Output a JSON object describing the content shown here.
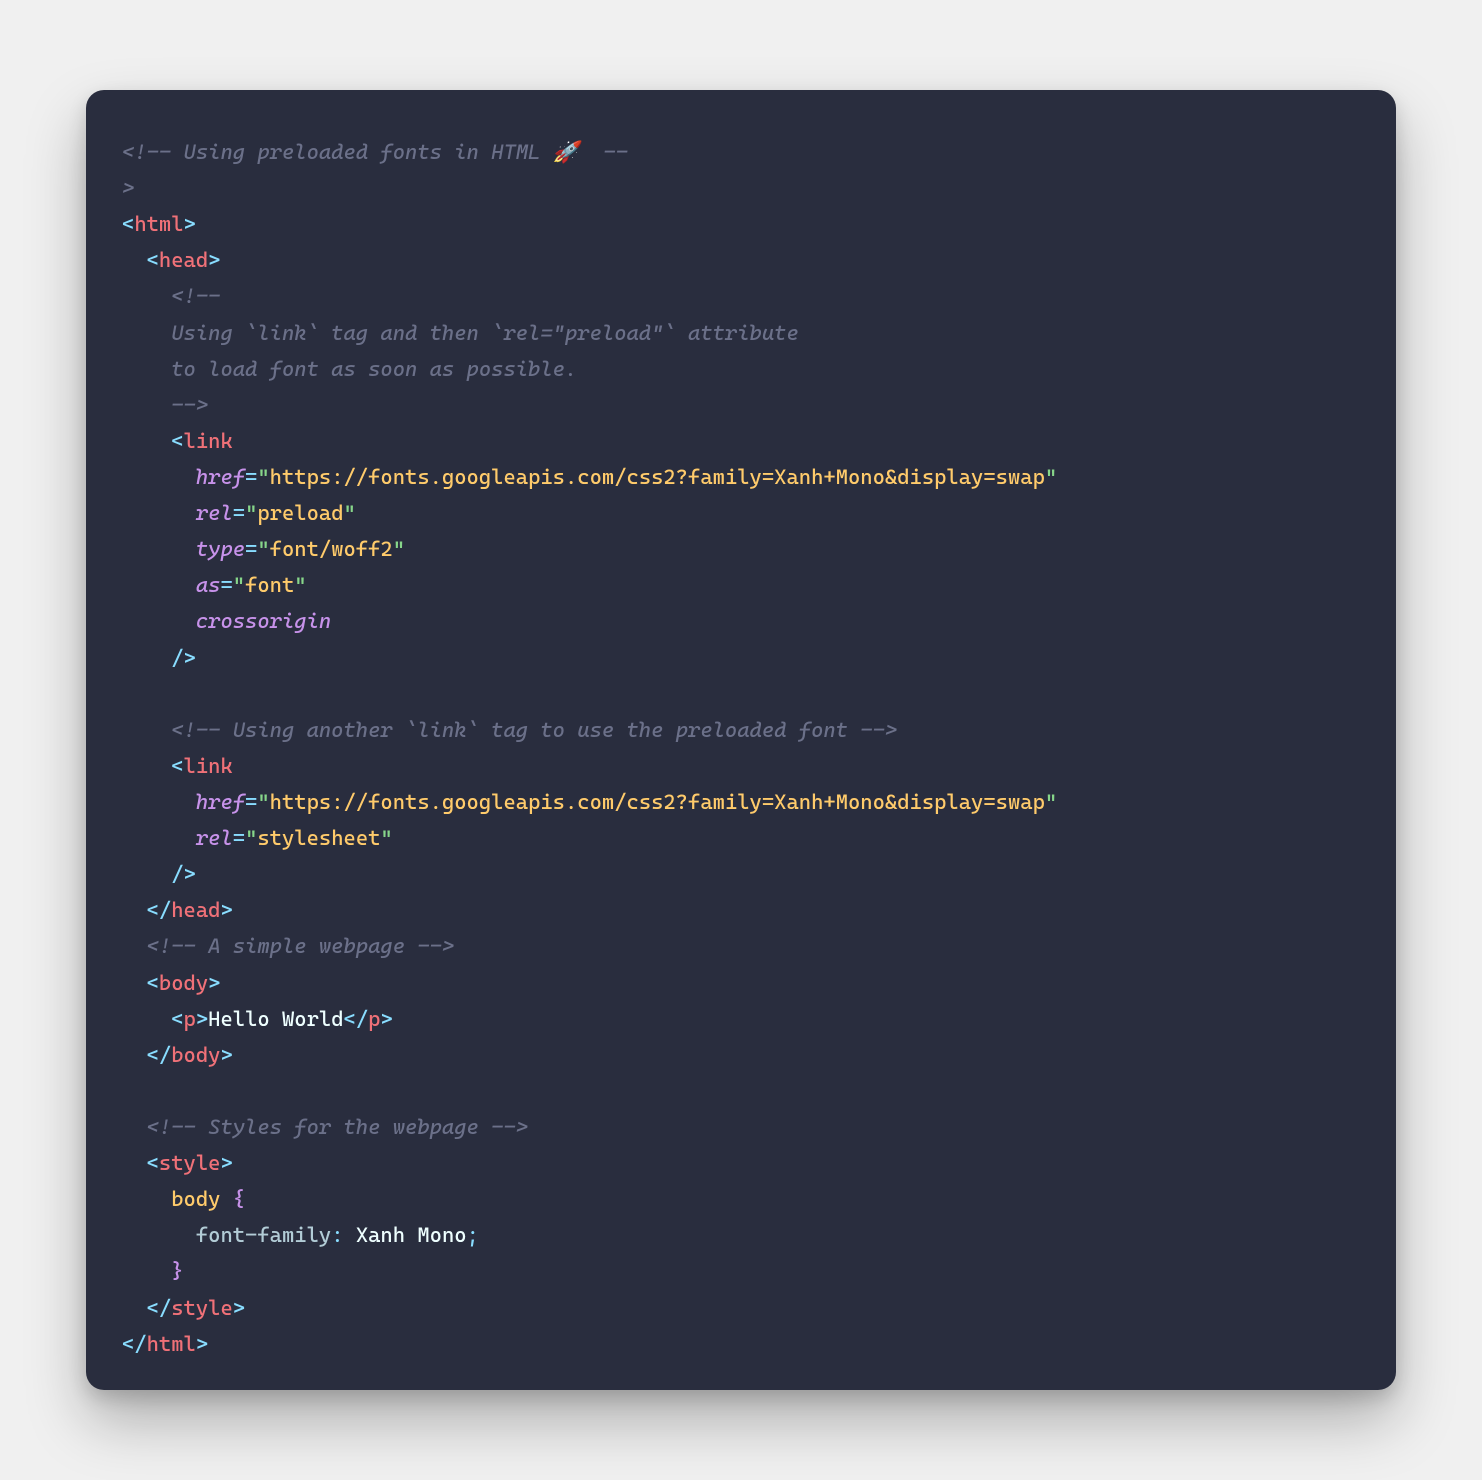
{
  "colors": {
    "background_page": "#f0f0f0",
    "background_card": "#292d3e",
    "comment": "#6b7089",
    "punctuation": "#89ddff",
    "tag": "#f07178",
    "attribute": "#c792ea",
    "string_value": "#ffcb6b",
    "string_quote": "#87d68a",
    "text": "#eeffff",
    "css_property": "#b2ccd6"
  },
  "lines": [
    [
      {
        "cls": "cm",
        "t": "<!-- Using preloaded fonts in HTML 🚀  --"
      }
    ],
    [
      {
        "cls": "cm",
        "t": ">"
      }
    ],
    [
      {
        "cls": "pn",
        "t": "<"
      },
      {
        "cls": "tg",
        "t": "html"
      },
      {
        "cls": "pn",
        "t": ">"
      }
    ],
    [
      {
        "t": "  "
      },
      {
        "cls": "pn",
        "t": "<"
      },
      {
        "cls": "tg",
        "t": "head"
      },
      {
        "cls": "pn",
        "t": ">"
      }
    ],
    [
      {
        "t": "    "
      },
      {
        "cls": "cm",
        "t": "<!--"
      }
    ],
    [
      {
        "t": "    "
      },
      {
        "cls": "cm",
        "t": "Using `link` tag and then `rel=\"preload\"` attribute"
      }
    ],
    [
      {
        "t": "    "
      },
      {
        "cls": "cm",
        "t": "to load font as soon as possible."
      }
    ],
    [
      {
        "t": "    "
      },
      {
        "cls": "cm",
        "t": "-->"
      }
    ],
    [
      {
        "t": "    "
      },
      {
        "cls": "pn",
        "t": "<"
      },
      {
        "cls": "tg",
        "t": "link"
      }
    ],
    [
      {
        "t": "      "
      },
      {
        "cls": "at",
        "t": "href"
      },
      {
        "cls": "eq",
        "t": "="
      },
      {
        "cls": "sq",
        "t": "\""
      },
      {
        "cls": "st",
        "t": "https://fonts.googleapis.com/css2?family=Xanh+Mono&display=swap"
      },
      {
        "cls": "sq",
        "t": "\""
      }
    ],
    [
      {
        "t": "      "
      },
      {
        "cls": "at",
        "t": "rel"
      },
      {
        "cls": "eq",
        "t": "="
      },
      {
        "cls": "sq",
        "t": "\""
      },
      {
        "cls": "st",
        "t": "preload"
      },
      {
        "cls": "sq",
        "t": "\""
      }
    ],
    [
      {
        "t": "      "
      },
      {
        "cls": "at",
        "t": "type"
      },
      {
        "cls": "eq",
        "t": "="
      },
      {
        "cls": "sq",
        "t": "\""
      },
      {
        "cls": "st",
        "t": "font/woff2"
      },
      {
        "cls": "sq",
        "t": "\""
      }
    ],
    [
      {
        "t": "      "
      },
      {
        "cls": "at",
        "t": "as"
      },
      {
        "cls": "eq",
        "t": "="
      },
      {
        "cls": "sq",
        "t": "\""
      },
      {
        "cls": "st",
        "t": "font"
      },
      {
        "cls": "sq",
        "t": "\""
      }
    ],
    [
      {
        "t": "      "
      },
      {
        "cls": "at",
        "t": "crossorigin"
      }
    ],
    [
      {
        "t": "    "
      },
      {
        "cls": "pn",
        "t": "/>"
      }
    ],
    [
      {
        "t": " "
      }
    ],
    [
      {
        "t": "    "
      },
      {
        "cls": "cm",
        "t": "<!-- Using another `link` tag to use the preloaded font -->"
      }
    ],
    [
      {
        "t": "    "
      },
      {
        "cls": "pn",
        "t": "<"
      },
      {
        "cls": "tg",
        "t": "link"
      }
    ],
    [
      {
        "t": "      "
      },
      {
        "cls": "at",
        "t": "href"
      },
      {
        "cls": "eq",
        "t": "="
      },
      {
        "cls": "sq",
        "t": "\""
      },
      {
        "cls": "st",
        "t": "https://fonts.googleapis.com/css2?family=Xanh+Mono&display=swap"
      },
      {
        "cls": "sq",
        "t": "\""
      }
    ],
    [
      {
        "t": "      "
      },
      {
        "cls": "at",
        "t": "rel"
      },
      {
        "cls": "eq",
        "t": "="
      },
      {
        "cls": "sq",
        "t": "\""
      },
      {
        "cls": "st",
        "t": "stylesheet"
      },
      {
        "cls": "sq",
        "t": "\""
      }
    ],
    [
      {
        "t": "    "
      },
      {
        "cls": "pn",
        "t": "/>"
      }
    ],
    [
      {
        "t": "  "
      },
      {
        "cls": "pn",
        "t": "</"
      },
      {
        "cls": "tg",
        "t": "head"
      },
      {
        "cls": "pn",
        "t": ">"
      }
    ],
    [
      {
        "t": "  "
      },
      {
        "cls": "cm",
        "t": "<!-- A simple webpage -->"
      }
    ],
    [
      {
        "t": "  "
      },
      {
        "cls": "pn",
        "t": "<"
      },
      {
        "cls": "tg",
        "t": "body"
      },
      {
        "cls": "pn",
        "t": ">"
      }
    ],
    [
      {
        "t": "    "
      },
      {
        "cls": "pn",
        "t": "<"
      },
      {
        "cls": "tg",
        "t": "p"
      },
      {
        "cls": "pn",
        "t": ">"
      },
      {
        "cls": "tx",
        "t": "Hello World"
      },
      {
        "cls": "pn",
        "t": "</"
      },
      {
        "cls": "tg",
        "t": "p"
      },
      {
        "cls": "pn",
        "t": ">"
      }
    ],
    [
      {
        "t": "  "
      },
      {
        "cls": "pn",
        "t": "</"
      },
      {
        "cls": "tg",
        "t": "body"
      },
      {
        "cls": "pn",
        "t": ">"
      }
    ],
    [
      {
        "t": " "
      }
    ],
    [
      {
        "t": "  "
      },
      {
        "cls": "cm",
        "t": "<!-- Styles for the webpage -->"
      }
    ],
    [
      {
        "t": "  "
      },
      {
        "cls": "pn",
        "t": "<"
      },
      {
        "cls": "tg",
        "t": "style"
      },
      {
        "cls": "pn",
        "t": ">"
      }
    ],
    [
      {
        "t": "    "
      },
      {
        "cls": "sel",
        "t": "body"
      },
      {
        "t": " "
      },
      {
        "cls": "bkt",
        "t": "{"
      }
    ],
    [
      {
        "t": "      "
      },
      {
        "cls": "prop",
        "t": "font-family"
      },
      {
        "cls": "pn",
        "t": ":"
      },
      {
        "t": " "
      },
      {
        "cls": "val",
        "t": "Xanh Mono"
      },
      {
        "cls": "pn",
        "t": ";"
      }
    ],
    [
      {
        "t": "    "
      },
      {
        "cls": "bkt",
        "t": "}"
      }
    ],
    [
      {
        "t": "  "
      },
      {
        "cls": "pn",
        "t": "</"
      },
      {
        "cls": "tg",
        "t": "style"
      },
      {
        "cls": "pn",
        "t": ">"
      }
    ],
    [
      {
        "cls": "pn",
        "t": "</"
      },
      {
        "cls": "tg",
        "t": "html"
      },
      {
        "cls": "pn",
        "t": ">"
      }
    ]
  ]
}
